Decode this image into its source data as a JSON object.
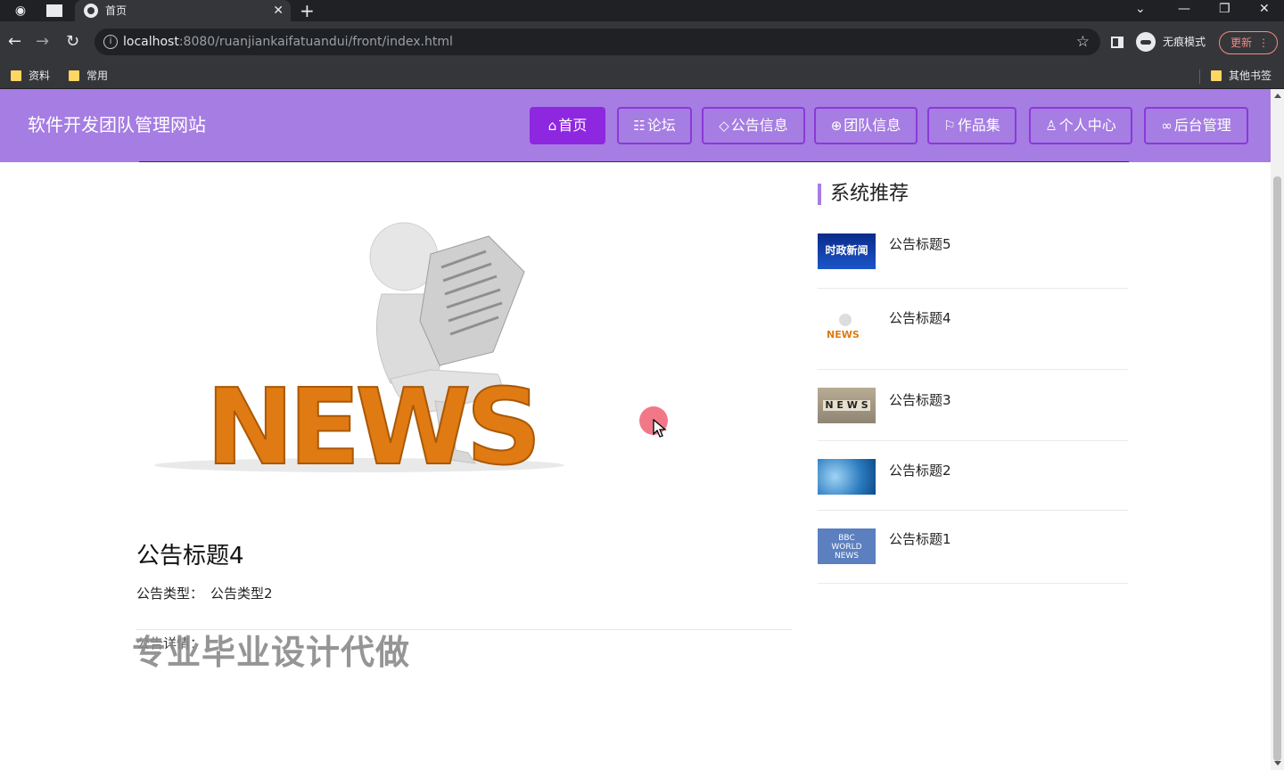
{
  "browser": {
    "tab_title": "首页",
    "url_host": "localhost",
    "url_rest": ":8080/ruanjiankaifatuandui/front/index.html",
    "incognito_label": "无痕模式",
    "update_label": "更新",
    "bookmarks": [
      "资料",
      "常用"
    ],
    "other_bookmarks": "其他书签"
  },
  "site": {
    "title": "软件开发团队管理网站",
    "nav": [
      {
        "label": "首页",
        "icon": "home-icon",
        "active": true
      },
      {
        "label": "论坛",
        "icon": "forum-icon",
        "active": false
      },
      {
        "label": "公告信息",
        "icon": "tag-icon",
        "active": false
      },
      {
        "label": "团队信息",
        "icon": "globe-icon",
        "active": false
      },
      {
        "label": "作品集",
        "icon": "flag-icon",
        "active": false
      },
      {
        "label": "个人中心",
        "icon": "user-icon",
        "active": false
      },
      {
        "label": "后台管理",
        "icon": "link-icon",
        "active": false
      }
    ]
  },
  "article": {
    "title": "公告标题4",
    "type_label": "公告类型：",
    "type_value": "公告类型2",
    "detail_label": "公告详情：",
    "watermark": "专业毕业设计代做",
    "hero_text": "NEWS"
  },
  "sidebar": {
    "title": "系统推荐",
    "items": [
      {
        "label": "公告标题5",
        "thumb": "时政新闻"
      },
      {
        "label": "公告标题4",
        "thumb": "NEWS"
      },
      {
        "label": "公告标题3",
        "thumb": "N E W S"
      },
      {
        "label": "公告标题2",
        "thumb": ""
      },
      {
        "label": "公告标题1",
        "thumb": "BBC WORLD NEWS"
      }
    ]
  },
  "colors": {
    "header_bg": "#a67de3",
    "nav_active": "#8e28e0",
    "nav_border": "#8a3ad8",
    "news_orange": "#e07a12"
  }
}
